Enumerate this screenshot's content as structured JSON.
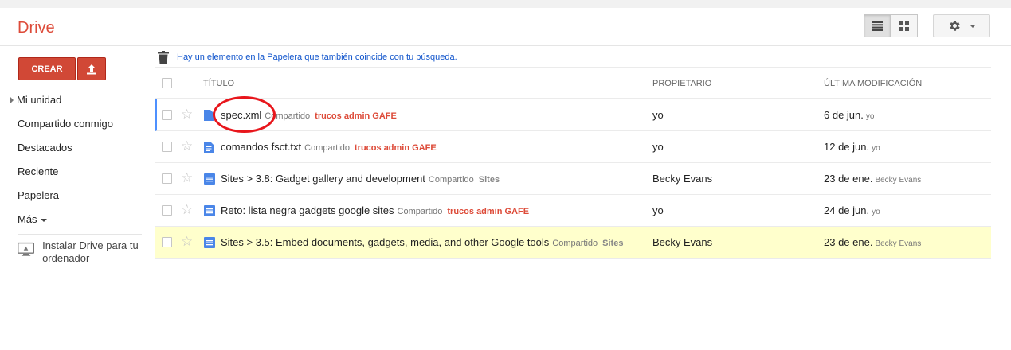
{
  "header": {
    "logo": "Drive",
    "views": [
      "list-view-icon",
      "grid-view-icon"
    ],
    "settings_icon": "gear-icon"
  },
  "sidebar": {
    "create_label": "CREAR",
    "upload_icon": "upload-icon",
    "items": [
      {
        "label": "Mi unidad",
        "active": true
      },
      {
        "label": "Compartido conmigo"
      },
      {
        "label": "Destacados"
      },
      {
        "label": "Reciente"
      },
      {
        "label": "Papelera"
      },
      {
        "label": "Más"
      }
    ],
    "install_label": "Instalar Drive para tu ordenador"
  },
  "main": {
    "trash_notice": "Hay un elemento en la Papelera que también coincide con tu búsqueda.",
    "columns": {
      "title": "TÍTULO",
      "owner": "PROPIETARIO",
      "modified": "ÚLTIMA MODIFICACIÓN"
    },
    "rows": [
      {
        "title": "spec.xml",
        "shared": "Compartido",
        "collection": "trucos admin GAFE",
        "owner": "yo",
        "modified": "6 de jun.",
        "by": "yo"
      },
      {
        "title": "comandos fsct.txt",
        "shared": "Compartido",
        "collection": "trucos admin GAFE",
        "owner": "yo",
        "modified": "12 de jun.",
        "by": "yo"
      },
      {
        "title": "Sites > 3.8: Gadget gallery and development",
        "shared": "Compartido",
        "collection": "Sites",
        "owner": "Becky Evans",
        "modified": "23 de ene.",
        "by": "Becky Evans"
      },
      {
        "title": "Reto: lista negra gadgets google sites",
        "shared": "Compartido",
        "collection": "trucos admin GAFE",
        "owner": "yo",
        "modified": "24 de jun.",
        "by": "yo"
      },
      {
        "title": "Sites > 3.5: Embed documents, gadgets, media, and other Google tools",
        "shared": "Compartido",
        "collection": "Sites",
        "owner": "Becky Evans",
        "modified": "23 de ene.",
        "by": "Becky Evans"
      }
    ]
  },
  "colors": {
    "brand_red": "#dd4b39",
    "link_blue": "#15c",
    "highlight_yellow": "#ffffcc",
    "annotation_red": "#e8161c"
  }
}
